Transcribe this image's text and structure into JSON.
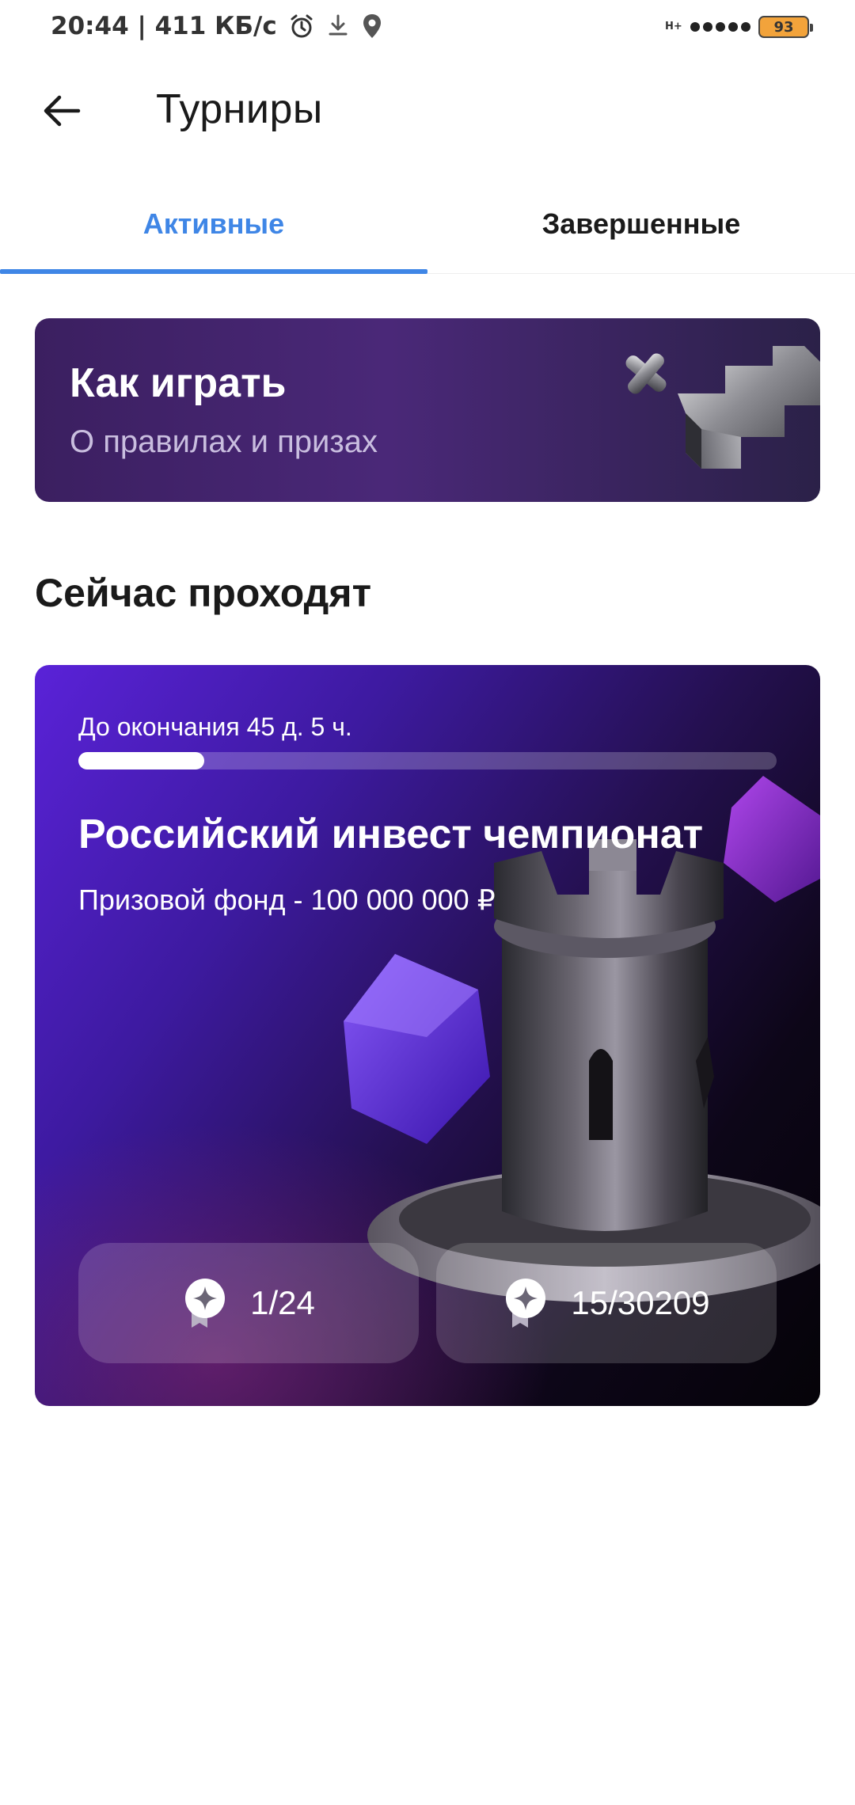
{
  "status_bar": {
    "time_speed": "20:44 | 411 КБ/с",
    "network": "H+",
    "battery": "93"
  },
  "app_bar": {
    "title": "Турниры"
  },
  "tabs": {
    "active_label": "Активные",
    "finished_label": "Завершенные"
  },
  "how_to_play": {
    "title": "Как играть",
    "subtitle": "О правилах и призах"
  },
  "section": {
    "title": "Сейчас проходят"
  },
  "tournament": {
    "deadline_text": "До окончания 45 д. 5 ч.",
    "progress_fraction": 0.18,
    "title": "Российский инвест чемпионат",
    "prize_text": "Призовой фонд - 100 000 000 ₽",
    "stat_left": "1/24",
    "stat_right": "15/30209"
  },
  "colors": {
    "accent": "#3f86e6",
    "card_purple": "#5a22d8"
  }
}
